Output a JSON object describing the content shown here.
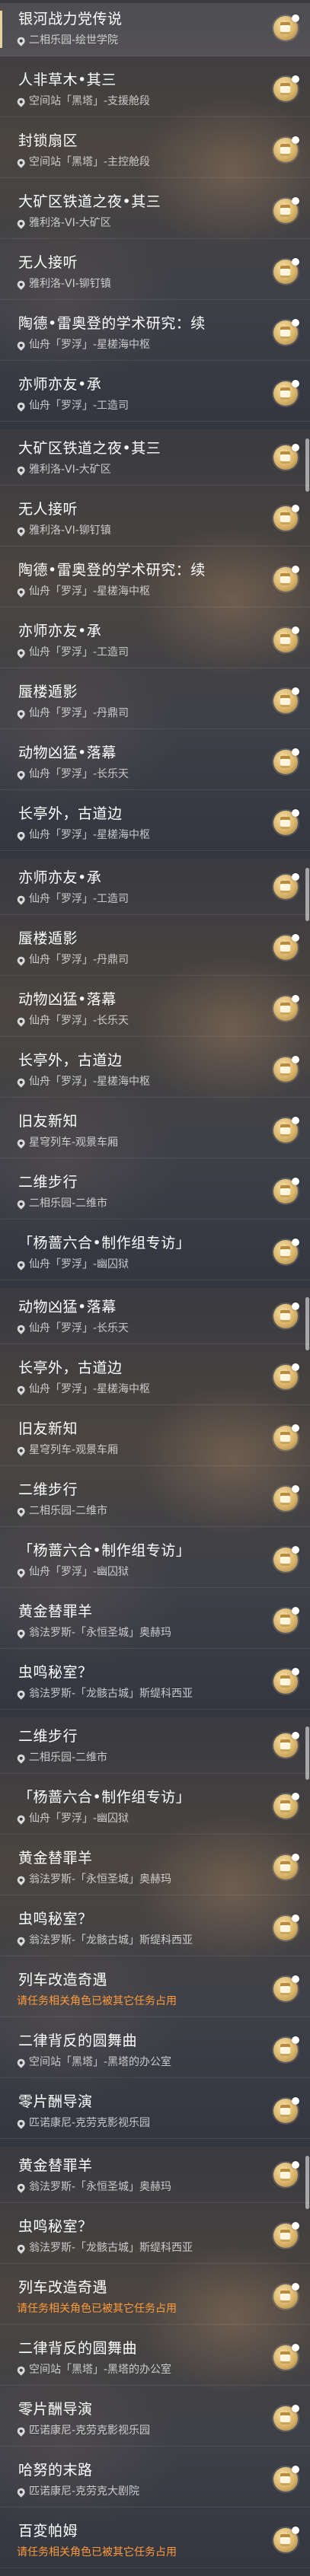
{
  "panels": [
    {
      "rows": [
        {
          "title": "银河战力党传说",
          "location": "二相乐园-绘世学院",
          "warn": false
        },
        {
          "title": "人非草木•其三",
          "location": "空间站「黑塔」-支援舱段",
          "warn": false
        },
        {
          "title": "封锁扇区",
          "location": "空间站「黑塔」-主控舱段",
          "warn": false
        },
        {
          "title": "大矿区铁道之夜•其三",
          "location": "雅利洛-VI-大矿区",
          "warn": false
        },
        {
          "title": "无人接听",
          "location": "雅利洛-VI-铆钉镇",
          "warn": false
        },
        {
          "title": "陶德•雷奥登的学术研究：续",
          "location": "仙舟「罗浮」-星槎海中枢",
          "warn": false
        },
        {
          "title": "亦师亦友•承",
          "location": "仙舟「罗浮」-工造司",
          "warn": false
        }
      ]
    },
    {
      "rows": [
        {
          "title": "大矿区铁道之夜•其三",
          "location": "雅利洛-VI-大矿区",
          "warn": false
        },
        {
          "title": "无人接听",
          "location": "雅利洛-VI-铆钉镇",
          "warn": false
        },
        {
          "title": "陶德•雷奥登的学术研究：续",
          "location": "仙舟「罗浮」-星槎海中枢",
          "warn": false
        },
        {
          "title": "亦师亦友•承",
          "location": "仙舟「罗浮」-工造司",
          "warn": false
        },
        {
          "title": "蜃楼遁影",
          "location": "仙舟「罗浮」-丹鼎司",
          "warn": false
        },
        {
          "title": "动物凶猛•落幕",
          "location": "仙舟「罗浮」-长乐天",
          "warn": false
        },
        {
          "title": "长亭外，古道边",
          "location": "仙舟「罗浮」-星槎海中枢",
          "warn": false
        }
      ]
    },
    {
      "rows": [
        {
          "title": "亦师亦友•承",
          "location": "仙舟「罗浮」-工造司",
          "warn": false
        },
        {
          "title": "蜃楼遁影",
          "location": "仙舟「罗浮」-丹鼎司",
          "warn": false
        },
        {
          "title": "动物凶猛•落幕",
          "location": "仙舟「罗浮」-长乐天",
          "warn": false
        },
        {
          "title": "长亭外，古道边",
          "location": "仙舟「罗浮」-星槎海中枢",
          "warn": false
        },
        {
          "title": "旧友新知",
          "location": "星穹列车-观景车厢",
          "warn": false
        },
        {
          "title": "二维步行",
          "location": "二相乐园-二维市",
          "warn": false
        },
        {
          "title": "「杨蔷六合•制作组专访」",
          "location": "仙舟「罗浮」-幽囚狱",
          "warn": false
        }
      ]
    },
    {
      "rows": [
        {
          "title": "动物凶猛•落幕",
          "location": "仙舟「罗浮」-长乐天",
          "warn": false
        },
        {
          "title": "长亭外，古道边",
          "location": "仙舟「罗浮」-星槎海中枢",
          "warn": false
        },
        {
          "title": "旧友新知",
          "location": "星穹列车-观景车厢",
          "warn": false
        },
        {
          "title": "二维步行",
          "location": "二相乐园-二维市",
          "warn": false
        },
        {
          "title": "「杨蔷六合•制作组专访」",
          "location": "仙舟「罗浮」-幽囚狱",
          "warn": false
        },
        {
          "title": "黄金替罪羊",
          "location": "翁法罗斯-「永恒圣城」奥赫玛",
          "warn": false
        },
        {
          "title": "虫鸣秘室？",
          "location": "翁法罗斯-「龙骸古城」斯缇科西亚",
          "warn": false
        }
      ]
    },
    {
      "rows": [
        {
          "title": "二维步行",
          "location": "二相乐园-二维市",
          "warn": false
        },
        {
          "title": "「杨蔷六合•制作组专访」",
          "location": "仙舟「罗浮」-幽囚狱",
          "warn": false
        },
        {
          "title": "黄金替罪羊",
          "location": "翁法罗斯-「永恒圣城」奥赫玛",
          "warn": false
        },
        {
          "title": "虫鸣秘室？",
          "location": "翁法罗斯-「龙骸古城」斯缇科西亚",
          "warn": false
        },
        {
          "title": "列车改造奇遇",
          "location": "请任务相关角色已被其它任务占用",
          "warn": true
        },
        {
          "title": "二律背反的圆舞曲",
          "location": "空间站「黑塔」-黑塔的办公室",
          "warn": false
        },
        {
          "title": "零片酬导演",
          "location": "匹诺康尼-克劳克影视乐园",
          "warn": false
        }
      ]
    },
    {
      "rows": [
        {
          "title": "黄金替罪羊",
          "location": "翁法罗斯-「永恒圣城」奥赫玛",
          "warn": false
        },
        {
          "title": "虫鸣秘室？",
          "location": "翁法罗斯-「龙骸古城」斯缇科西亚",
          "warn": false
        },
        {
          "title": "列车改造奇遇",
          "location": "请任务相关角色已被其它任务占用",
          "warn": true
        },
        {
          "title": "二律背反的圆舞曲",
          "location": "空间站「黑塔」-黑塔的办公室",
          "warn": false
        },
        {
          "title": "零片酬导演",
          "location": "匹诺康尼-克劳克影视乐园",
          "warn": false
        },
        {
          "title": "哈努的末路",
          "location": "匹诺康尼-克劳克大剧院",
          "warn": false
        },
        {
          "title": "百変帕姆",
          "location": "请任务相关角色已被其它任务占用",
          "warn": true
        }
      ]
    }
  ],
  "colors": {
    "warn": "#ff9a3c",
    "accent": "#e8d3a0"
  }
}
